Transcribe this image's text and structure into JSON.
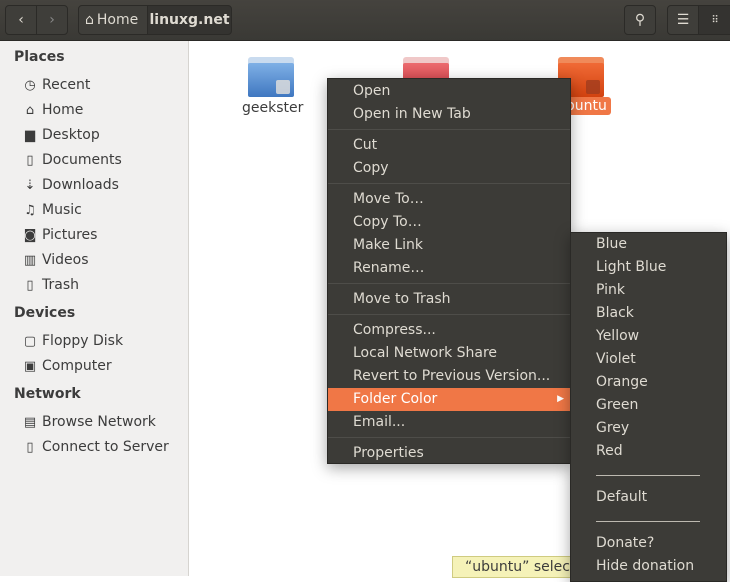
{
  "header": {
    "back_icon": "chevron-left-icon",
    "forward_icon": "chevron-right-icon",
    "breadcrumbs": [
      "Home",
      "linuxg.net"
    ],
    "search_icon": "search-icon",
    "list_view_icon": "list-icon",
    "grid_view_icon": "grid-icon"
  },
  "sidebar": {
    "places_label": "Places",
    "places": [
      {
        "label": "Recent",
        "icon": "clock-icon"
      },
      {
        "label": "Home",
        "icon": "home-icon"
      },
      {
        "label": "Desktop",
        "icon": "folder-icon"
      },
      {
        "label": "Documents",
        "icon": "document-icon"
      },
      {
        "label": "Downloads",
        "icon": "download-icon"
      },
      {
        "label": "Music",
        "icon": "music-icon"
      },
      {
        "label": "Pictures",
        "icon": "camera-icon"
      },
      {
        "label": "Videos",
        "icon": "film-icon"
      },
      {
        "label": "Trash",
        "icon": "trash-icon"
      }
    ],
    "devices_label": "Devices",
    "devices": [
      {
        "label": "Floppy Disk",
        "icon": "floppy-icon"
      },
      {
        "label": "Computer",
        "icon": "computer-icon"
      }
    ],
    "network_label": "Network",
    "network": [
      {
        "label": "Browse Network",
        "icon": "network-icon"
      },
      {
        "label": "Connect to Server",
        "icon": "server-icon"
      }
    ]
  },
  "files": [
    {
      "name": "geekster",
      "color": "#5a8fd0"
    },
    {
      "name": "",
      "color": "#d9474e"
    },
    {
      "name": "ubuntu",
      "color": "#e0561f",
      "selected": true
    }
  ],
  "context_menu": {
    "items": [
      "Open",
      "Open in New Tab",
      "Cut",
      "Copy",
      "Move To…",
      "Copy To…",
      "Make Link",
      "Rename…",
      "Move to Trash",
      "Compress...",
      "Local Network Share",
      "Revert to Previous Version...",
      "Folder Color",
      "Email...",
      "Properties"
    ],
    "highlighted": "Folder Color"
  },
  "submenu": {
    "colors": [
      "Blue",
      "Light Blue",
      "Pink",
      "Black",
      "Yellow",
      "Violet",
      "Orange",
      "Green",
      "Grey",
      "Red"
    ],
    "default": "Default",
    "donate": "Donate?",
    "hide_donation": "Hide donation"
  },
  "status": "“ubuntu” selected",
  "accent": "#f07746"
}
